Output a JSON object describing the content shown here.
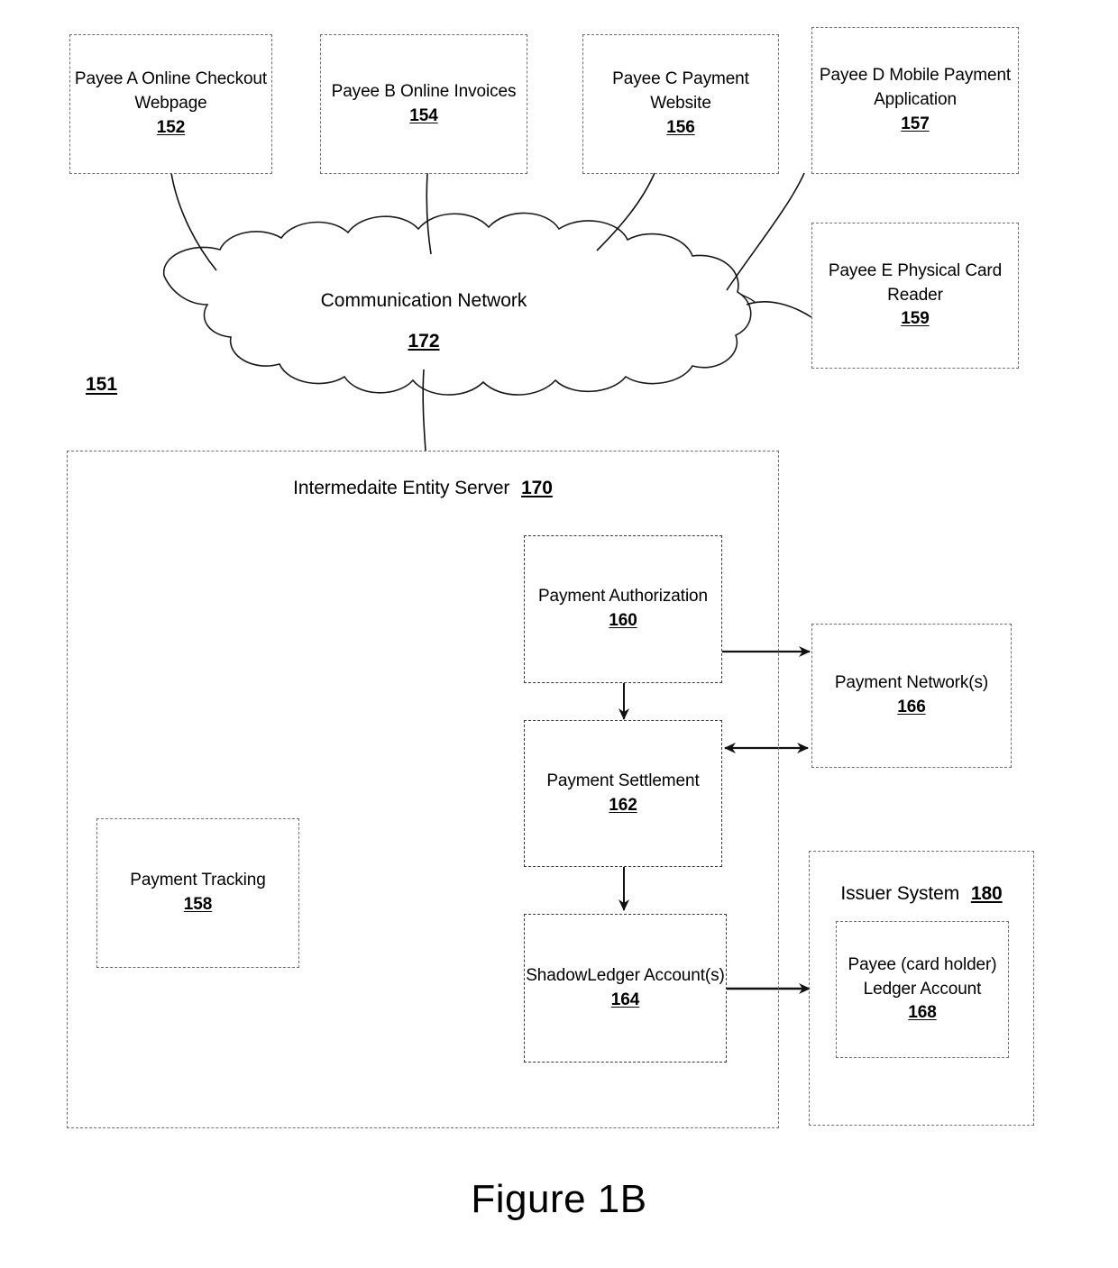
{
  "figure": {
    "caption": "Figure 1B",
    "system_ref": "151"
  },
  "payee_endpoints": [
    {
      "name": "payee-a",
      "label": "Payee A Online Checkout Webpage",
      "line1": "Payee A Online Checkout",
      "line2": "Webpage",
      "ref": "152"
    },
    {
      "name": "payee-b",
      "label": "Payee B Online Invoices",
      "line1": "Payee B Online Invoices",
      "line2": "",
      "ref": "154"
    },
    {
      "name": "payee-c",
      "label": "Payee C Payment Website",
      "line1": "Payee C Payment Website",
      "line2": "",
      "ref": "156"
    },
    {
      "name": "payee-d",
      "label": "Payee D Mobile Payment Application",
      "line1": "Payee D Mobile Payment",
      "line2": "Application",
      "ref": "157"
    },
    {
      "name": "payee-e",
      "label": "Payee E Physical Card Reader",
      "line1": "Payee E Physical Card",
      "line2": "Reader",
      "ref": "159"
    }
  ],
  "network": {
    "label": "Communication Network",
    "ref": "172",
    "shape": "cloud"
  },
  "server": {
    "title": "Intermedaite Entity Server",
    "ref": "170",
    "modules": [
      {
        "name": "payment-tracking",
        "label": "Payment Tracking",
        "ref": "158"
      },
      {
        "name": "payment-authorization",
        "label": "Payment Authorization",
        "ref": "160"
      },
      {
        "name": "payment-settlement",
        "label": "Payment Settlement",
        "ref": "162"
      },
      {
        "name": "shadow-ledger-accounts",
        "label": "ShadowLedger Account(s)",
        "ref": "164"
      }
    ]
  },
  "payment_network": {
    "label": "Payment Network(s)",
    "ref": "166"
  },
  "issuer_system": {
    "title": "Issuer System",
    "ref": "180",
    "account": {
      "line1": "Payee (card holder)",
      "line2": "Ledger Account",
      "ref": "168"
    }
  },
  "connections": [
    {
      "from": "payee-a",
      "to": "communication-network",
      "style": "curve"
    },
    {
      "from": "payee-b",
      "to": "communication-network",
      "style": "curve"
    },
    {
      "from": "payee-c",
      "to": "communication-network",
      "style": "curve"
    },
    {
      "from": "payee-d",
      "to": "communication-network",
      "style": "curve"
    },
    {
      "from": "payee-e",
      "to": "communication-network",
      "style": "curve"
    },
    {
      "from": "communication-network",
      "to": "intermediate-entity-server",
      "style": "curve"
    },
    {
      "from": "payment-authorization",
      "to": "payment-network",
      "style": "arrow"
    },
    {
      "from": "payment-authorization",
      "to": "payment-settlement",
      "style": "arrow"
    },
    {
      "from": "payment-settlement",
      "to": "payment-network",
      "style": "double-arrow"
    },
    {
      "from": "payment-settlement",
      "to": "shadow-ledger-accounts",
      "style": "arrow"
    },
    {
      "from": "shadow-ledger-accounts",
      "to": "payee-ledger-account",
      "style": "arrow"
    }
  ],
  "colors": {
    "line": "#000000",
    "box_border": "#6f6f6f",
    "background": "#ffffff"
  }
}
